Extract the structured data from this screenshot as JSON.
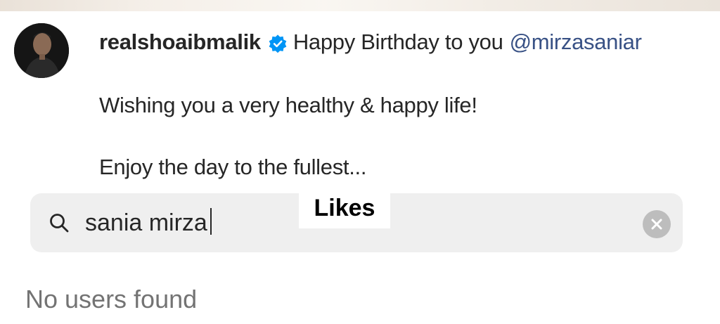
{
  "post": {
    "username": "realshoaibmalik",
    "verified_icon": "verified-badge-icon",
    "caption_text": "Happy Birthday to you",
    "mention": "@mirzasaniar",
    "line2": "Wishing you a very healthy & happy life!",
    "line3": "Enjoy the day to the fullest..."
  },
  "likes_panel": {
    "title": "Likes",
    "search": {
      "value": "sania mirza",
      "icon": "search-icon",
      "clear_icon": "clear-icon"
    },
    "empty_message": "No users found"
  },
  "colors": {
    "mention": "#385185",
    "verified": "#0095f6",
    "search_bg": "#efefef",
    "muted_text": "#737373"
  }
}
